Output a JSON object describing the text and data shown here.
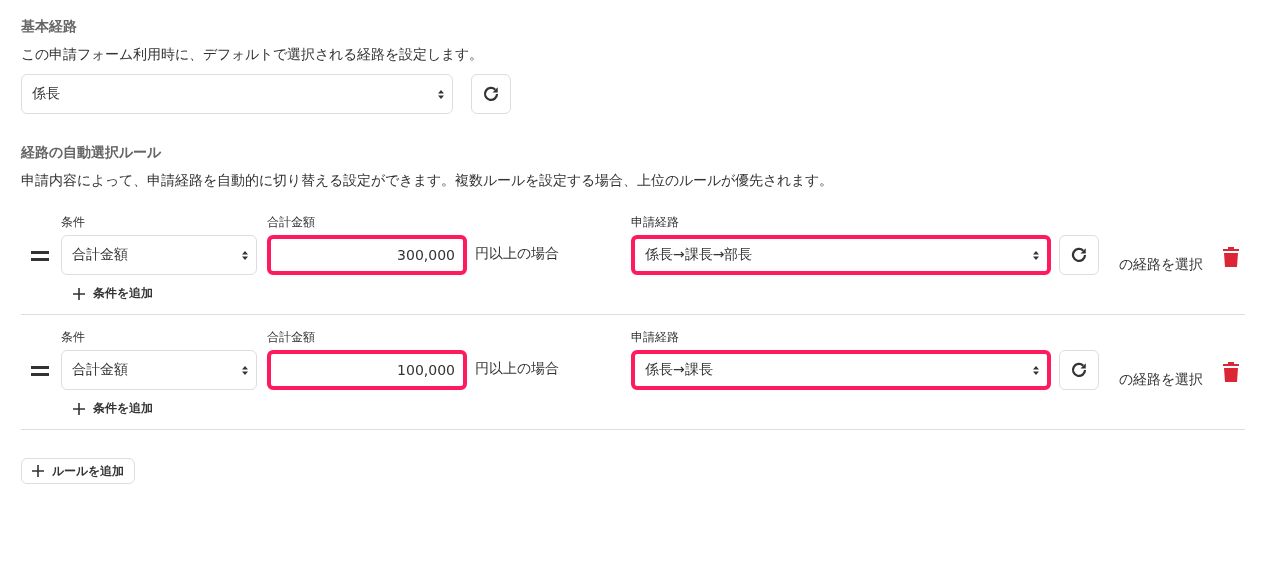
{
  "default_route": {
    "heading": "基本経路",
    "description": "この申請フォーム利用時に、デフォルトで選択される経路を設定します。",
    "route_select": {
      "value": "係長"
    }
  },
  "auto_rules": {
    "heading": "経路の自動選択ルール",
    "description": "申請内容によって、申請経路を自動的に切り替える設定ができます。複数ルールを設定する場合、上位のルールが優先されます。",
    "rules": [
      {
        "condition_label": "条件",
        "condition": "合計金額",
        "amount_label": "合計金額",
        "amount": "300,000",
        "amount_highlighted": true,
        "suffix": "円以上の場合",
        "route_label": "申請経路",
        "route": "係長→課長→部長",
        "route_highlighted": true,
        "select_text": "の経路を選択",
        "add_condition": "条件を追加"
      },
      {
        "condition_label": "条件",
        "condition": "合計金額",
        "amount_label": "合計金額",
        "amount": "100,000",
        "amount_highlighted": true,
        "suffix": "円以上の場合",
        "route_label": "申請経路",
        "route": "係長→課長",
        "route_highlighted": true,
        "select_text": "の経路を選択",
        "add_condition": "条件を追加"
      }
    ],
    "add_rule": "ルールを追加"
  }
}
